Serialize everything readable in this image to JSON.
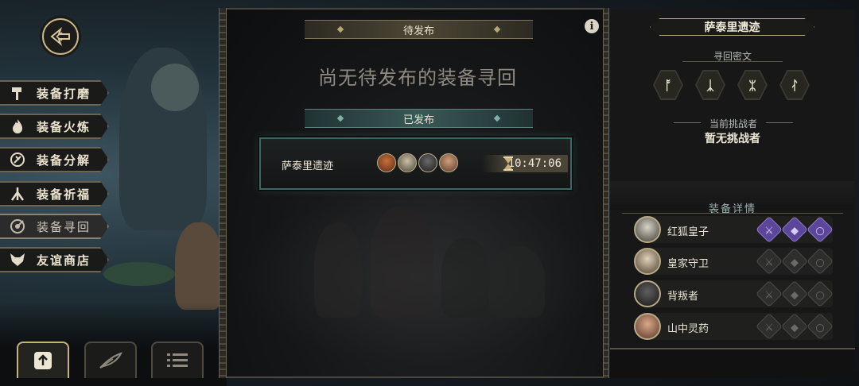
{
  "menu": {
    "items": [
      {
        "label": "装备打磨",
        "icon": "hammer-icon"
      },
      {
        "label": "装备火炼",
        "icon": "flame-icon"
      },
      {
        "label": "装备分解",
        "icon": "disassemble-icon"
      },
      {
        "label": "装备祈福",
        "icon": "prayer-icon"
      },
      {
        "label": "装备寻回",
        "icon": "target-icon",
        "active": true
      },
      {
        "label": "友谊商店",
        "icon": "fox-icon"
      }
    ]
  },
  "bottom_tabs": [
    {
      "icon": "upload-icon",
      "active": true
    },
    {
      "icon": "feather-icon",
      "active": false
    },
    {
      "icon": "list-icon",
      "active": false
    }
  ],
  "center": {
    "pending_label": "待发布",
    "empty_message": "尚无待发布的装备寻回",
    "published_label": "已发布",
    "quest": {
      "name": "萨泰里遗迹",
      "time": "10:47:06",
      "avatars": [
        "hero-avatar-1",
        "hero-avatar-2",
        "hero-avatar-3",
        "hero-avatar-4"
      ]
    }
  },
  "right": {
    "title": "萨泰里遗迹",
    "runes_label": "寻回密文",
    "runes": [
      "ᚩ",
      "ᛣ",
      "ᛯ",
      "ᛮ"
    ],
    "challenger_label": "当前挑战者",
    "challenger_value": "暂无挑战者",
    "equip_label": "装备详情",
    "heroes": [
      {
        "name": "红狐皇子",
        "slots": [
          "on",
          "on",
          "on"
        ]
      },
      {
        "name": "皇家守卫",
        "slots": [
          "off",
          "off",
          "off"
        ]
      },
      {
        "name": "背叛者",
        "slots": [
          "off",
          "off",
          "off"
        ]
      },
      {
        "name": "山中灵药",
        "slots": [
          "off",
          "off",
          "off"
        ]
      }
    ]
  },
  "colors": {
    "gold": "#c9b788",
    "teal": "#3f6662",
    "purple": "#5b4699"
  }
}
